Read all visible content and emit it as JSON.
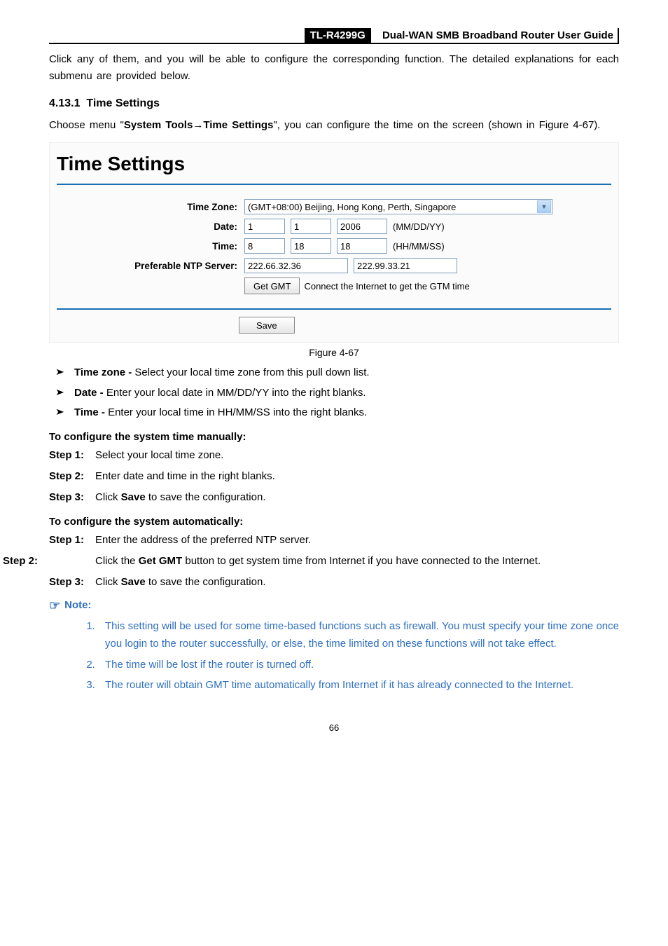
{
  "header": {
    "model": "TL-R4299G",
    "title": "Dual-WAN SMB Broadband Router User Guide"
  },
  "intro": "Click any of them, and you will be able to configure the corresponding function. The detailed explanations for each submenu are provided below.",
  "section_number": "4.13.1",
  "section_title": "Time Settings",
  "menu_sentence_prefix": "Choose menu \"",
  "menu_path_1": "System Tools",
  "menu_arrow": "→",
  "menu_path_2": "Time Settings",
  "menu_sentence_suffix": "\", you can configure the time on the screen (shown in Figure 4-67).",
  "panel": {
    "heading": "Time Settings",
    "rows": {
      "timezone_label": "Time Zone:",
      "timezone_value": "(GMT+08:00) Beijing, Hong Kong, Perth, Singapore",
      "date_label": "Date:",
      "date_mm": "1",
      "date_dd": "1",
      "date_yy": "2006",
      "date_unit": "(MM/DD/YY)",
      "time_label": "Time:",
      "time_hh": "8",
      "time_mm": "18",
      "time_ss": "18",
      "time_unit": "(HH/MM/SS)",
      "ntp_label": "Preferable NTP Server:",
      "ntp1": "222.66.32.36",
      "ntp2": "222.99.33.21",
      "get_gmt_btn": "Get GMT",
      "get_gmt_hint": "Connect the Internet to get the GTM time",
      "save_btn": "Save"
    }
  },
  "figure_caption": "Figure 4-67",
  "bullets": [
    {
      "term": "Time zone -",
      "desc": " Select your local time zone from this pull down list."
    },
    {
      "term": "Date -",
      "desc": " Enter your local date in MM/DD/YY into the right blanks."
    },
    {
      "term": "Time -",
      "desc": " Enter your local time in HH/MM/SS into the right blanks."
    }
  ],
  "manual_heading": "To configure the system time manually:",
  "manual_steps": [
    {
      "label": "Step 1:",
      "text": "Select your local time zone."
    },
    {
      "label": "Step 2:",
      "text": "Enter date and time in the right blanks."
    },
    {
      "label": "Step 3:",
      "pre": "Click ",
      "bold": "Save",
      "post": " to save the configuration."
    }
  ],
  "auto_heading": "To configure the system automatically:",
  "auto_steps": [
    {
      "label": "Step 1:",
      "text": "Enter the address of the preferred NTP server."
    },
    {
      "label": "Step 2:",
      "pre": "Click the ",
      "bold": "Get GMT",
      "post": " button to get system time from Internet if you have connected to the Internet."
    },
    {
      "label": "Step 3:",
      "pre": "Click ",
      "bold": "Save",
      "post": " to save the configuration."
    }
  ],
  "note_label": "Note:",
  "notes": [
    "This setting will be used for some time-based functions such as firewall. You must specify your time zone once you login to the router successfully, or else, the time limited on these functions will not take effect.",
    "The time will be lost if the router is turned off.",
    "The router will obtain GMT time automatically from Internet if it has already connected to the Internet."
  ],
  "page_number": "66"
}
